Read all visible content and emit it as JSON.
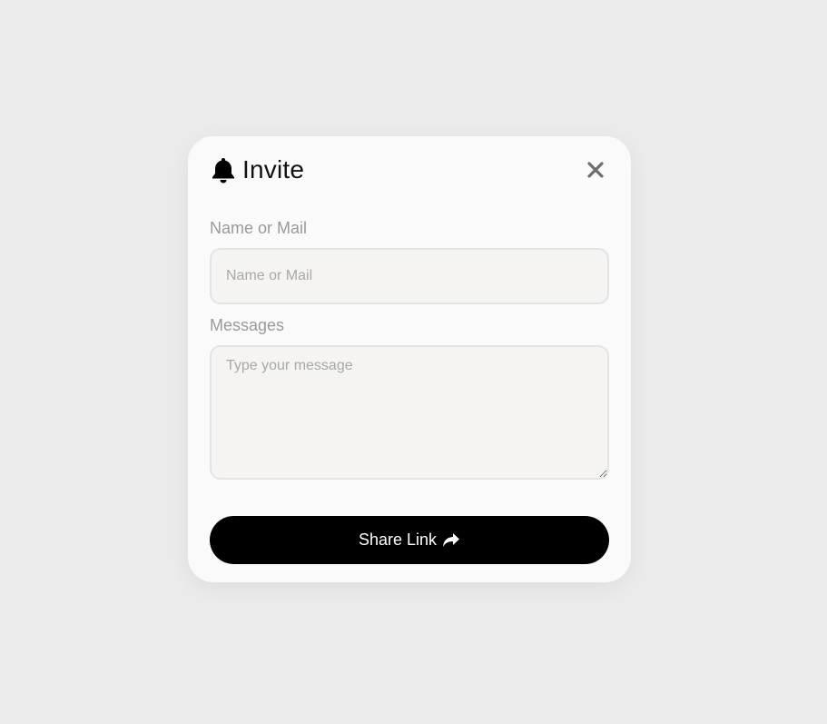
{
  "modal": {
    "title": "Invite",
    "title_icon": "bell-icon",
    "close_icon": "close-icon"
  },
  "form": {
    "name_label": "Name or Mail",
    "name_placeholder": "Name or Mail",
    "name_value": "",
    "message_label": "Messages",
    "message_placeholder": "Type your message",
    "message_value": ""
  },
  "actions": {
    "share_label": "Share Link",
    "share_icon": "share-arrow-icon"
  },
  "colors": {
    "background": "#ebebeb",
    "card": "#fafafa",
    "button": "#000000",
    "button_text": "#ffffff",
    "label": "#9a9a9a",
    "input_bg": "#f5f4f2"
  }
}
